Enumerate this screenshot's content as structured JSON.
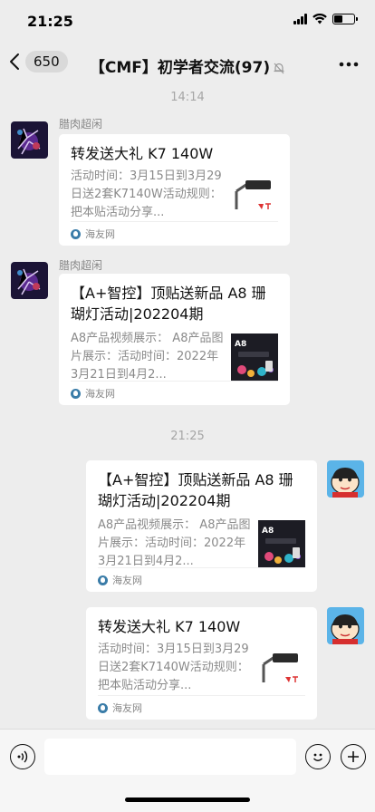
{
  "status_bar": {
    "time": "21:25"
  },
  "nav": {
    "unread_count": "650",
    "title": "【CMF】初学者交流(97)"
  },
  "timestamps": [
    "14:14",
    "21:25"
  ],
  "messages": [
    {
      "sender": "腊肉超闲",
      "title": "转发送大礼  K7 140W",
      "desc": "活动时间：3月15日到3月29日送2套K7140W活动规则：把本贴活动分享...",
      "source": "海友网",
      "thumb_icon": "k7-light-thumbnail"
    },
    {
      "sender": "腊肉超闲",
      "title": "【A+智控】顶贴送新品 A8 珊瑚灯活动|202204期",
      "desc": "A8产品视频展示：  A8产品图片展示：活动时间：2022年3月21日到4月2...",
      "source": "海友网",
      "thumb_icon": "a8-light-thumbnail"
    },
    {
      "title": "【A+智控】顶贴送新品 A8 珊瑚灯活动|202204期",
      "desc": "A8产品视频展示：  A8产品图片展示：活动时间：2022年3月21日到4月2...",
      "source": "海友网",
      "thumb_icon": "a8-light-thumbnail"
    },
    {
      "title": "转发送大礼  K7 140W",
      "desc": "活动时间：3月15日到3月29日送2套K7140W活动规则：把本贴活动分享...",
      "source": "海友网",
      "thumb_icon": "k7-light-thumbnail"
    }
  ],
  "colors": {
    "background": "#EDEDED",
    "card": "#FFFFFF",
    "muted_text": "#8A8A8A",
    "source_icon": "#3A7CA8"
  }
}
